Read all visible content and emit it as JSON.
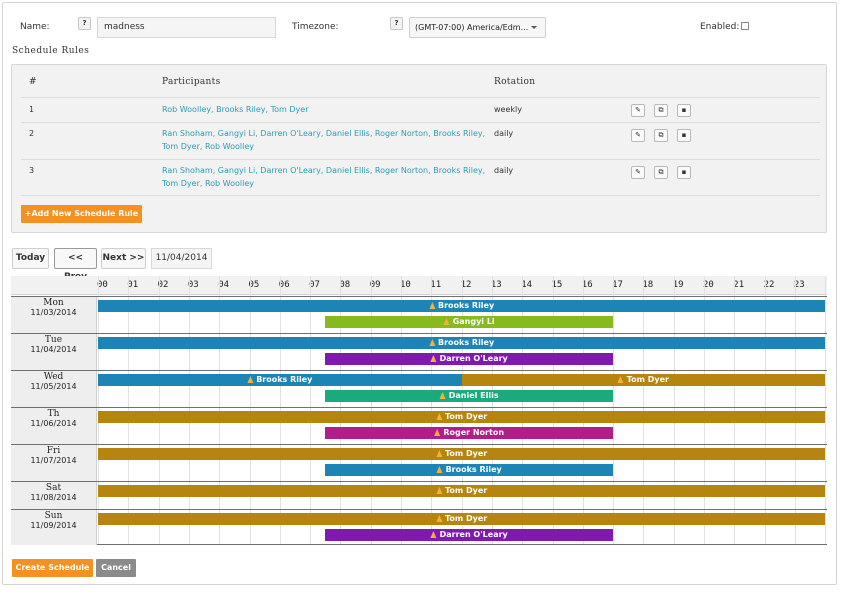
{
  "form": {
    "name_label": "Name:",
    "name_value": "madness",
    "timezone_label": "Timezone:",
    "timezone_value": "(GMT-07:00) America/Edm...",
    "enabled_label": "Enabled:",
    "help_label": "?"
  },
  "rules": {
    "title": "Schedule Rules",
    "headers": {
      "num": "#",
      "participants": "Participants",
      "rotation": "Rotation"
    },
    "rows": [
      {
        "num": "1",
        "participants": "Rob Woolley, Brooks Riley, Tom Dyer",
        "participants_line2": "",
        "rotation": "weekly"
      },
      {
        "num": "2",
        "participants": "Ran Shoham, Gangyi Li, Darren O'Leary, Daniel Ellis, Roger Norton, Brooks Riley,",
        "participants_line2": "Tom Dyer, Rob Woolley",
        "rotation": "daily"
      },
      {
        "num": "3",
        "participants": "Ran Shoham, Gangyi Li, Darren O'Leary, Daniel Ellis, Roger Norton, Brooks Riley,",
        "participants_line2": "Tom Dyer, Rob Woolley",
        "rotation": "daily"
      }
    ],
    "icons": {
      "edit": "✎",
      "copy": "⧉",
      "delete": "▪"
    },
    "add_label": "+Add New Schedule Rule"
  },
  "nav": {
    "today_label": "Today",
    "prev_label": "<< Prev",
    "next_label": "Next >>",
    "current_date": "11/04/2014"
  },
  "hours": [
    "00",
    "01",
    "02",
    "03",
    "04",
    "05",
    "06",
    "07",
    "08",
    "09",
    "10",
    "11",
    "12",
    "13",
    "14",
    "15",
    "16",
    "17",
    "18",
    "19",
    "20",
    "21",
    "22",
    "23"
  ],
  "colors": {
    "blue": "#1d85b6",
    "green": "#86ba1f",
    "purple": "#7f1ab0",
    "gold": "#b5850f",
    "teal": "#1baa7e",
    "magenta": "#b21c8b",
    "orange_button": "#f39223",
    "gray_button": "#8b8b8b"
  },
  "days": [
    {
      "name": "Mon",
      "date": "11/03/2014",
      "rows": [
        [
          {
            "name": "Brooks Riley",
            "start": 0,
            "end": 24,
            "color": "blue"
          }
        ],
        [
          {
            "name": "Gangyi Li",
            "start": 7.5,
            "end": 17,
            "color": "green"
          }
        ]
      ]
    },
    {
      "name": "Tue",
      "date": "11/04/2014",
      "rows": [
        [
          {
            "name": "Brooks Riley",
            "start": 0,
            "end": 24,
            "color": "blue"
          }
        ],
        [
          {
            "name": "Darren O'Leary",
            "start": 7.5,
            "end": 17,
            "color": "purple"
          }
        ]
      ]
    },
    {
      "name": "Wed",
      "date": "11/05/2014",
      "rows": [
        [
          {
            "name": "Brooks Riley",
            "start": 0,
            "end": 12,
            "color": "blue"
          },
          {
            "name": "Tom Dyer",
            "start": 12,
            "end": 24,
            "color": "gold"
          }
        ],
        [
          {
            "name": "Daniel Ellis",
            "start": 7.5,
            "end": 17,
            "color": "teal"
          }
        ]
      ]
    },
    {
      "name": "Th",
      "date": "11/06/2014",
      "rows": [
        [
          {
            "name": "Tom Dyer",
            "start": 0,
            "end": 24,
            "color": "gold"
          }
        ],
        [
          {
            "name": "Roger Norton",
            "start": 7.5,
            "end": 17,
            "color": "magenta"
          }
        ]
      ]
    },
    {
      "name": "Fri",
      "date": "11/07/2014",
      "rows": [
        [
          {
            "name": "Tom Dyer",
            "start": 0,
            "end": 24,
            "color": "gold"
          }
        ],
        [
          {
            "name": "Brooks Riley",
            "start": 7.5,
            "end": 17,
            "color": "blue"
          }
        ]
      ]
    },
    {
      "name": "Sat",
      "date": "11/08/2014",
      "rows": [
        [
          {
            "name": "Tom Dyer",
            "start": 0,
            "end": 24,
            "color": "gold"
          }
        ]
      ]
    },
    {
      "name": "Sun",
      "date": "11/09/2014",
      "rows": [
        [
          {
            "name": "Tom Dyer",
            "start": 0,
            "end": 24,
            "color": "gold"
          }
        ],
        [
          {
            "name": "Darren O'Leary",
            "start": 7.5,
            "end": 17,
            "color": "purple"
          }
        ]
      ]
    }
  ],
  "footer": {
    "create_label": "Create Schedule",
    "cancel_label": "Cancel"
  }
}
